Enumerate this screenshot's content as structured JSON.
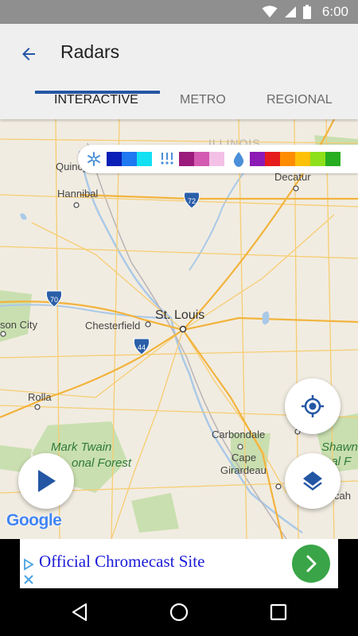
{
  "status_bar": {
    "time": "6:00",
    "icons": [
      "wifi-icon",
      "cell-signal-icon",
      "battery-icon"
    ]
  },
  "app_bar": {
    "title": "Radars",
    "back_icon": "arrow-left-icon"
  },
  "tabs": [
    {
      "label": "INTERACTIVE",
      "selected": true
    },
    {
      "label": "METRO",
      "selected": false
    },
    {
      "label": "REGIONAL",
      "selected": false
    }
  ],
  "colors": {
    "accent": "#2456a4",
    "ad_button": "#3aa548",
    "ad_link": "#1a1ad6"
  },
  "legend": {
    "snow_icon": "snowflake-icon",
    "snow_colors": [
      "#0a1fb5",
      "#1e78f0",
      "#13e0f2"
    ],
    "mix_icon": "sleet-icon",
    "mix_colors": [
      "#9a1b7b",
      "#d35bb2",
      "#f4c1e6"
    ],
    "rain_icon": "raindrop-icon",
    "rain_colors": [
      "#8c1ab5",
      "#e61c1c",
      "#ff8c00",
      "#ffc107",
      "#8ee01a",
      "#27ad20"
    ]
  },
  "map": {
    "labels": {
      "illinois": "ILLINOIS",
      "quincy": "Quincy",
      "hannibal": "Hannibal",
      "decatur": "Decatur",
      "st_louis": "St. Louis",
      "chesterfield": "Chesterfield",
      "jefferson_city": "son City",
      "rolla": "Rolla",
      "mark_twain_1": "Mark Twain",
      "mark_twain_2": "onal Forest",
      "carbondale": "Carbondale",
      "cape_girardeau_1": "Cape",
      "cape_girardeau_2": "Girardeau",
      "shawnee_1": "Shawn",
      "shawnee_2": "nal F",
      "marion": "M",
      "paducah": "cah"
    },
    "shields": {
      "i72": "72",
      "i70": "70",
      "i44": "44"
    },
    "attribution": "Google"
  },
  "controls": {
    "play_icon": "play-icon",
    "locate_icon": "my-location-icon",
    "layers_icon": "layers-icon"
  },
  "ad": {
    "text": "Official Chromecast Site",
    "adchoices_icon": "adchoices-icon",
    "close_icon": "close-icon",
    "go_icon": "chevron-right-icon"
  },
  "nav_bar": {
    "back_icon": "nav-back-icon",
    "home_icon": "nav-home-icon",
    "recents_icon": "nav-recents-icon"
  }
}
